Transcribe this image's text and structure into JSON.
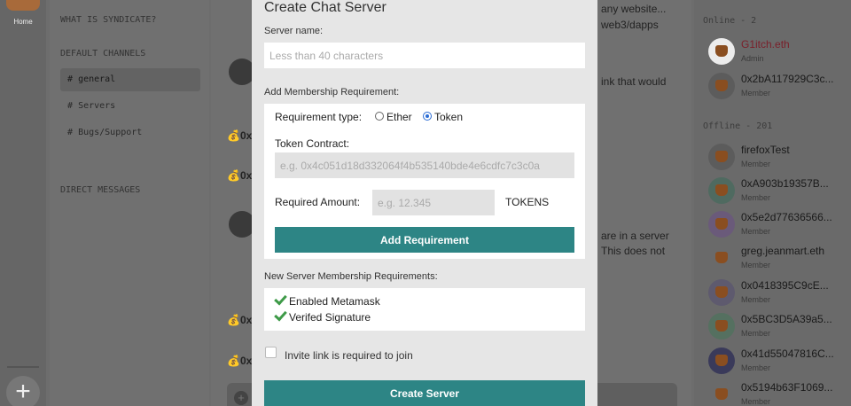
{
  "rail": {
    "home_label": "Home",
    "add_label": "+"
  },
  "channels": {
    "server_title": "WHAT IS SYNDICATE?",
    "default_heading": "DEFAULT CHANNELS",
    "items": [
      {
        "hash": "#",
        "label": "general"
      },
      {
        "hash": "#",
        "label": "Servers"
      },
      {
        "hash": "#",
        "label": "Bugs/Support"
      }
    ],
    "dm_heading": "DIRECT MESSAGES"
  },
  "chat": {
    "snippets": [
      "any website...",
      "web3/dapps",
      "ink that would",
      "are in a server",
      "This does not"
    ],
    "address_prefix": "0x",
    "input_plus": "+"
  },
  "members": {
    "online_heading": "Online - 2",
    "offline_heading": "Offline - 201",
    "online": [
      {
        "name": "G1itch.eth",
        "role": "Admin"
      },
      {
        "name": "0x2bA117929C3c...",
        "role": "Member"
      }
    ],
    "offline": [
      {
        "name": "firefoxTest",
        "role": "Member"
      },
      {
        "name": "0xA903b19357B...",
        "role": "Member"
      },
      {
        "name": "0x5e2d77636566...",
        "role": "Member"
      },
      {
        "name": "greg.jeanmart.eth",
        "role": "Member"
      },
      {
        "name": "0x0418395C9cE...",
        "role": "Member"
      },
      {
        "name": "0x5BC3D5A39a5...",
        "role": "Member"
      },
      {
        "name": "0x41d55047816C...",
        "role": "Member"
      },
      {
        "name": "0x5194b63F1069...",
        "role": "Member"
      }
    ]
  },
  "modal": {
    "title": "Create Chat Server",
    "server_name_label": "Server name:",
    "server_name_placeholder": "Less than 40 characters",
    "add_membership_label": "Add Membership Requirement:",
    "requirement_type_label": "Requirement type:",
    "option_ether": "Ether",
    "option_token": "Token",
    "selected_type": "Token",
    "token_contract_label": "Token Contract:",
    "token_contract_placeholder": "e.g. 0x4c051d18d332064f4b535140bde4e6cdfc7c3c0a",
    "required_amount_label": "Required Amount:",
    "required_amount_placeholder": "e.g. 12.345",
    "tokens_unit": "TOKENS",
    "add_requirement_button": "Add Requirement",
    "new_requirements_label": "New Server Membership Requirements:",
    "requirements": [
      "Enabled Metamask",
      "Verifed Signature"
    ],
    "invite_link_label": "Invite link is required to join",
    "invite_link_checked": false,
    "create_button": "Create Server"
  }
}
